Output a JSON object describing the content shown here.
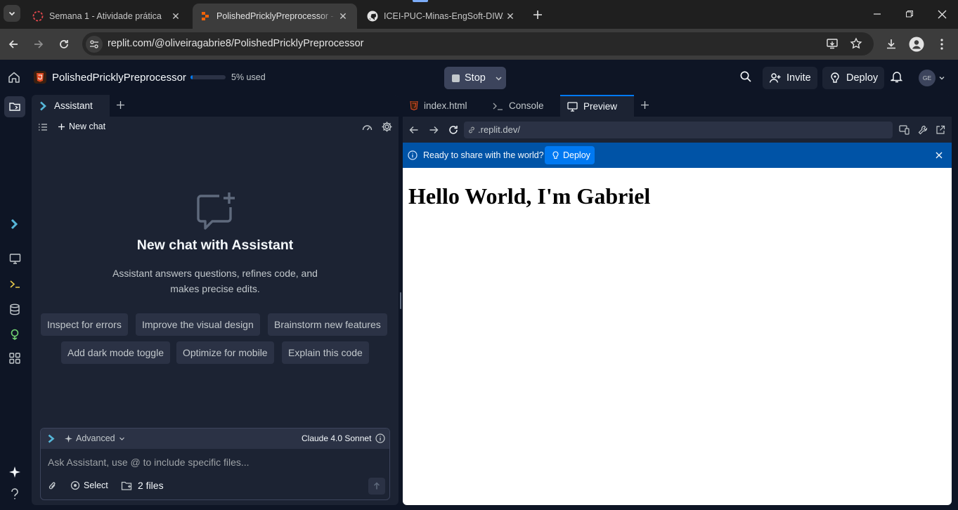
{
  "browser": {
    "tabs": [
      {
        "title": "Semana 1 - Atividade prática"
      },
      {
        "title": "PolishedPricklyPreprocessor - Replit"
      },
      {
        "title": "ICEI-PUC-Minas-EngSoft-DIW/t"
      }
    ],
    "url": "replit.com/@oliveiragabrie8/PolishedPricklyPreprocessor"
  },
  "header": {
    "project_name": "PolishedPricklyPreprocessor",
    "usage_label": "5% used",
    "usage_fraction": 0.05,
    "stop_label": "Stop",
    "invite_label": "Invite",
    "deploy_label": "Deploy",
    "avatar_initials": "GE"
  },
  "assistant": {
    "tab_label": "Assistant",
    "new_chat_label": "New chat",
    "heading": "New chat with Assistant",
    "description_line1": "Assistant answers questions, refines code, and",
    "description_line2": "makes precise edits.",
    "suggestions": [
      "Inspect for errors",
      "Improve the visual design",
      "Brainstorm new features",
      "Add dark mode toggle",
      "Optimize for mobile",
      "Explain this code"
    ],
    "mode_label": "Advanced",
    "model_label": "Claude 4.0 Sonnet",
    "input_placeholder": "Ask Assistant, use @ to include specific files...",
    "select_label": "Select",
    "files_label": "2 files"
  },
  "workspace": {
    "tabs": [
      {
        "label": "index.html"
      },
      {
        "label": "Console"
      },
      {
        "label": "Preview"
      }
    ],
    "preview_url": ".replit.dev/",
    "banner_text": "Ready to share with the world?",
    "banner_deploy_label": "Deploy",
    "page_heading": "Hello World, I'm Gabriel"
  },
  "colors": {
    "accent": "#0053a6",
    "tab_underline": "#0079f2",
    "usage_bar": "#0079f2"
  }
}
